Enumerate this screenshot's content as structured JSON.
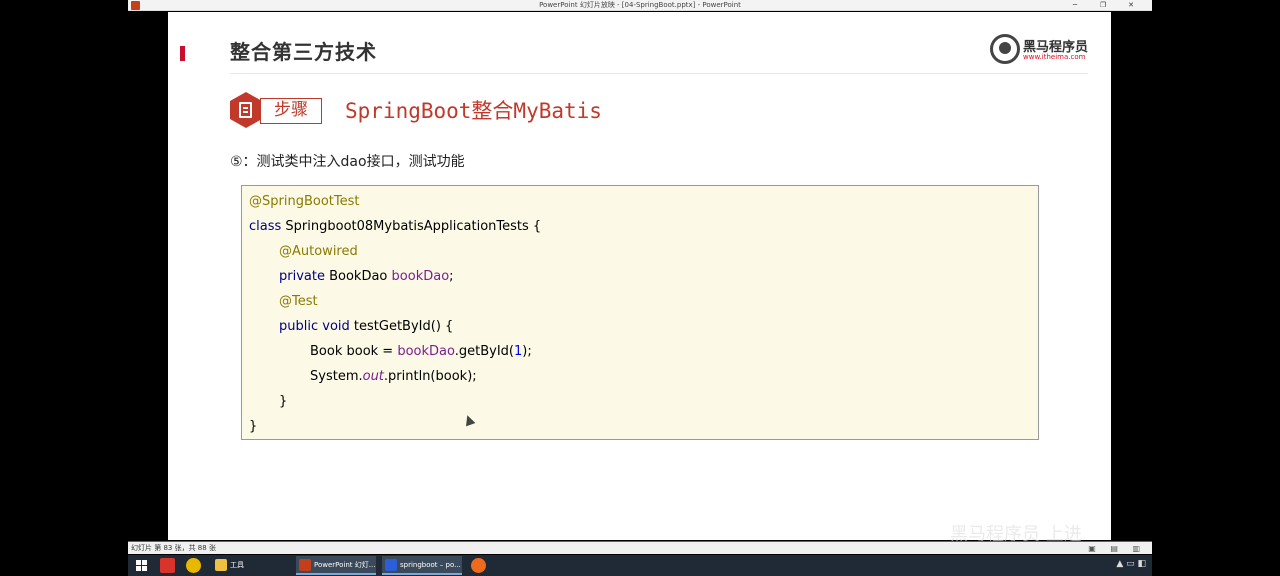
{
  "window": {
    "title": "PowerPoint 幻灯片放映 - [04-SpringBoot.pptx] - PowerPoint",
    "controls": {
      "minimize": "─",
      "maximize": "❐",
      "close": "✕"
    }
  },
  "slide": {
    "header_title": "整合第三方技术",
    "logo": {
      "text": "黑马程序员",
      "url": "www.itheima.com"
    },
    "step": {
      "label": "步骤",
      "title": "SpringBoot整合MyBatis"
    },
    "instruction": "⑤：测试类中注入dao接口，测试功能",
    "code": {
      "line1_annotation": "@SpringBootTest",
      "line2_kw": "class",
      "line2_rest": " Springboot08MybatisApplicationTests {",
      "line3_annotation": "@Autowired",
      "line4_kw": "private",
      "line4_type": " BookDao ",
      "line4_field": "bookDao",
      "line4_end": ";",
      "line5_annotation": "@Test",
      "line6_kw1": "public",
      "line6_kw2": " void",
      "line6_rest": " testGetById() {",
      "line7_a": "Book book = ",
      "line7_field": "bookDao",
      "line7_b": ".getById(",
      "line7_num": "1",
      "line7_c": ");",
      "line8_a": "System.",
      "line8_out": "out",
      "line8_b": ".println(book);",
      "line9": "}",
      "line10": "}"
    }
  },
  "statusbar": {
    "slide_info": "幻灯片 第 83 张，共 88 张",
    "watermark": "黑马程序员 上进"
  },
  "taskbar": {
    "explorer_label": "工具",
    "ppt_label": "PowerPoint 幻灯...",
    "idea_label": "springboot – po...",
    "colors": {
      "ppt": "#c43e1c",
      "idea": "#2b5fd9",
      "chrome": "#e8b700",
      "folder": "#f0c040",
      "app1": "#d9342b",
      "app2": "#f06a1c"
    }
  }
}
